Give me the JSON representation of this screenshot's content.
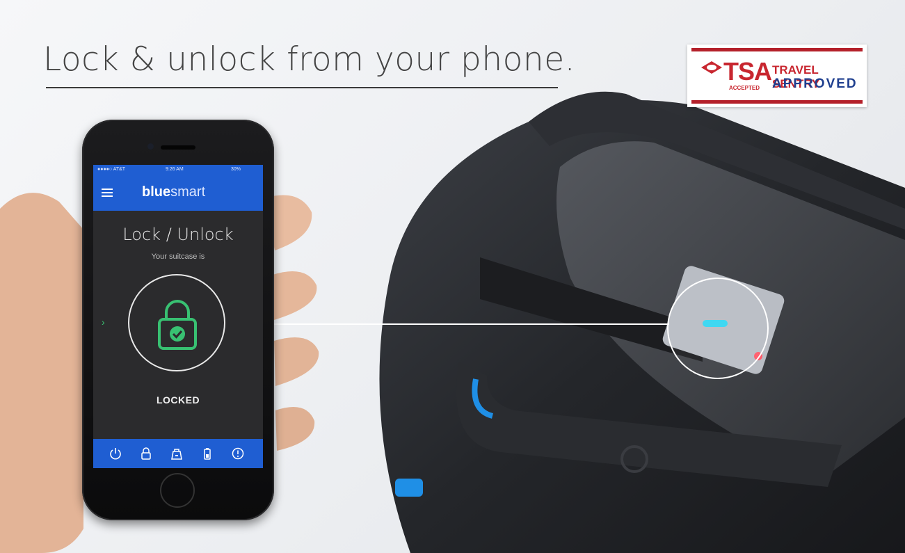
{
  "headline": "Lock & unlock from your phone.",
  "badge": {
    "tsa": "TSA",
    "tsa_sub": "ACCEPTED",
    "travel_sentry_line1": "TRAVEL SENTRY",
    "travel_sentry_line2": "APPROVED",
    "colors": {
      "red": "#c8262f",
      "blue": "#1f3f8f"
    }
  },
  "phone": {
    "status_bar": {
      "carrier": "●●●●○ AT&T",
      "time": "9:26 AM",
      "battery": "30%"
    },
    "brand_bold": "blue",
    "brand_light": "smart",
    "screen_title": "Lock / Unlock",
    "screen_subtitle": "Your suitcase is",
    "lock_state": "LOCKED",
    "tabs": [
      "power-icon",
      "lock-icon",
      "suitcase-lock-icon",
      "battery-icon",
      "alert-icon"
    ],
    "accent": "#1f5ed2",
    "lock_color": "#38c172"
  }
}
